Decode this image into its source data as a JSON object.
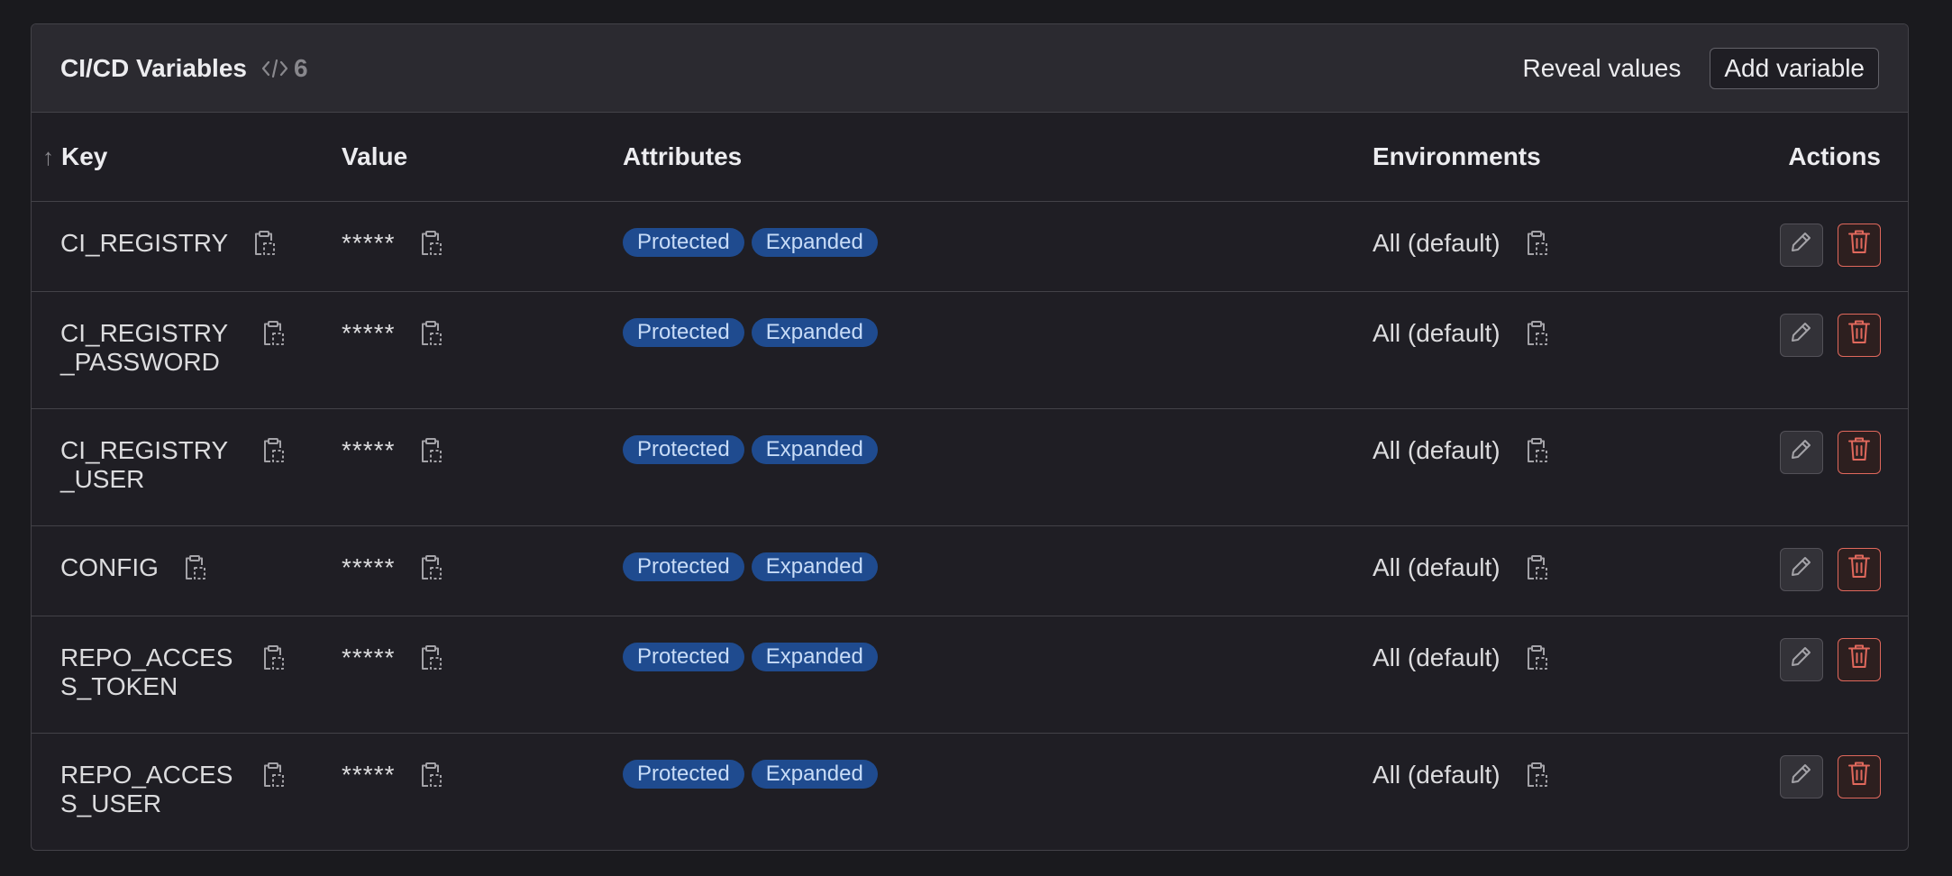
{
  "header": {
    "title": "CI/CD Variables",
    "count": "6",
    "reveal_label": "Reveal values",
    "add_label": "Add variable"
  },
  "table": {
    "columns": {
      "key": "Key",
      "value": "Value",
      "attributes": "Attributes",
      "environments": "Environments",
      "actions": "Actions"
    },
    "rows": [
      {
        "key": "CI_REGISTRY",
        "value": "*****",
        "badges": [
          "Protected",
          "Expanded"
        ],
        "env": "All (default)"
      },
      {
        "key": "CI_REGISTRY_PASSWORD",
        "value": "*****",
        "badges": [
          "Protected",
          "Expanded"
        ],
        "env": "All (default)"
      },
      {
        "key": "CI_REGISTRY_USER",
        "value": "*****",
        "badges": [
          "Protected",
          "Expanded"
        ],
        "env": "All (default)"
      },
      {
        "key": "CONFIG",
        "value": "*****",
        "badges": [
          "Protected",
          "Expanded"
        ],
        "env": "All (default)"
      },
      {
        "key": "REPO_ACCESS_TOKEN",
        "value": "*****",
        "badges": [
          "Protected",
          "Expanded"
        ],
        "env": "All (default)"
      },
      {
        "key": "REPO_ACCESS_USER",
        "value": "*****",
        "badges": [
          "Protected",
          "Expanded"
        ],
        "env": "All (default)"
      }
    ]
  },
  "colors": {
    "background": "#1a1a1e",
    "card": "#1f1e24",
    "header": "#2b2a30",
    "badge_bg": "#1f4b8f",
    "badge_text": "#c8dcf7",
    "danger": "#e0685c"
  },
  "icons": {
    "count": "code-icon",
    "sort": "arrow-up-icon",
    "copy": "clipboard-icon",
    "edit": "pencil-icon",
    "delete": "trash-icon"
  }
}
